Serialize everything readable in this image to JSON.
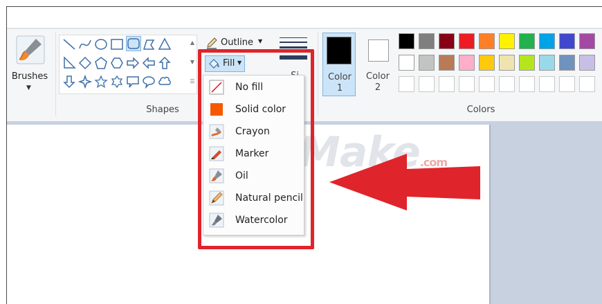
{
  "ribbon": {
    "brushes_label": "Brushes",
    "shapes_group_label": "Shapes",
    "colors_group_label": "Colors",
    "outline_label": "Outline",
    "fill_label": "Fill",
    "size_label_partial": "Si",
    "color1_label_a": "Color",
    "color1_label_b": "1",
    "color2_label_a": "Color",
    "color2_label_b": "2",
    "color1_value": "#000000",
    "color2_value": "#ffffff"
  },
  "palette": {
    "row1": [
      "#000000",
      "#7f7f7f",
      "#880015",
      "#ed1c24",
      "#ff7f27",
      "#fff200",
      "#22b14c",
      "#00a2e8",
      "#3f48cc",
      "#a349a4"
    ],
    "row2": [
      "#ffffff",
      "#c3c3c3",
      "#b97a57",
      "#ffaec9",
      "#ffc90e",
      "#efe4b0",
      "#b5e61d",
      "#99d9ea",
      "#7092be",
      "#c8bfe7"
    ]
  },
  "fill_menu": {
    "items": [
      {
        "label": "No fill",
        "icon": "no-fill-icon"
      },
      {
        "label": "Solid color",
        "icon": "solid-color-icon"
      },
      {
        "label": "Crayon",
        "icon": "crayon-icon"
      },
      {
        "label": "Marker",
        "icon": "marker-icon"
      },
      {
        "label": "Oil",
        "icon": "oil-brush-icon"
      },
      {
        "label": "Natural pencil",
        "icon": "natural-pencil-icon"
      },
      {
        "label": "Watercolor",
        "icon": "watercolor-icon"
      }
    ]
  },
  "watermark": {
    "text": "TipsMake",
    "suffix": ".com"
  },
  "accents": {
    "highlight": "#e0242b",
    "arrow": "#e0242b",
    "selected_tool": "#cce4f7"
  }
}
